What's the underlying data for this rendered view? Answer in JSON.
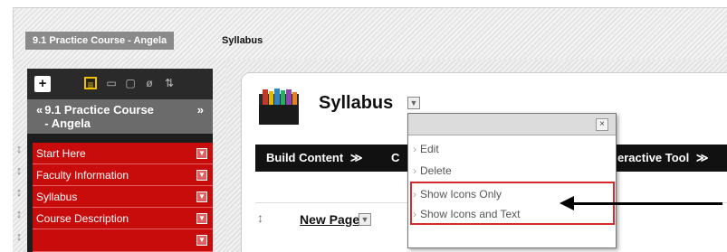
{
  "breadcrumb": {
    "course": "9.1 Practice Course - Angela",
    "page": "Syllabus"
  },
  "course_menu": {
    "toolbar_icons": [
      "add-icon",
      "list-view-icon",
      "folder-view-icon",
      "window-icon",
      "refresh-icon",
      "sort-icon"
    ],
    "course_title": "9.1 Practice Course - Angela",
    "collapse_symbol": "«",
    "expand_symbol": "»",
    "items": [
      {
        "label": "Start Here"
      },
      {
        "label": "Faculty Information"
      },
      {
        "label": "Syllabus"
      },
      {
        "label": "Course Description"
      }
    ]
  },
  "content": {
    "page_title": "Syllabus",
    "action_bar": {
      "build_content": "Build Content",
      "partial_c": "C",
      "interactive_tool": "eractive Tool"
    },
    "new_page": "New Page"
  },
  "dropdown": {
    "close": "×",
    "items": [
      {
        "label": "Edit"
      },
      {
        "label": "Delete"
      },
      {
        "label": "Show Icons Only"
      },
      {
        "label": "Show Icons and Text"
      }
    ]
  },
  "colors": {
    "menu_red": "#c80b0b",
    "highlight_red": "#d62b2b",
    "action_bar": "#111111"
  }
}
